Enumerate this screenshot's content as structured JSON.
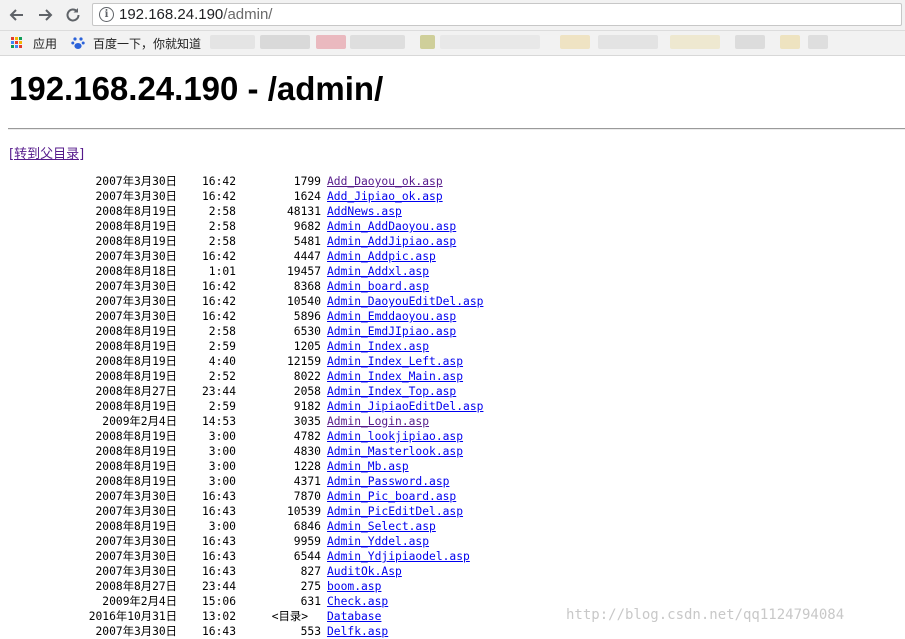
{
  "browser": {
    "url_host": "192.168.24.190",
    "url_path": "/admin/",
    "bookmarks": [
      {
        "label": "应用",
        "icon": "apps-grid-icon"
      },
      {
        "label": "百度一下，你就知道",
        "icon": "baidu-paw-icon"
      }
    ]
  },
  "page": {
    "title": "192.168.24.190 - /admin/",
    "parent_link": "[转到父目录]",
    "entries": [
      {
        "date": "2007年3月30日",
        "time": "16:42",
        "size": "1799",
        "name": "Add_Daoyou_ok.asp",
        "visited": true
      },
      {
        "date": "2007年3月30日",
        "time": "16:42",
        "size": "1624",
        "name": "Add_Jipiao_ok.asp",
        "visited": false
      },
      {
        "date": "2008年8月19日",
        "time": "2:58",
        "size": "48131",
        "name": "AddNews.asp",
        "visited": false
      },
      {
        "date": "2008年8月19日",
        "time": "2:58",
        "size": "9682",
        "name": "Admin_AddDaoyou.asp",
        "visited": false
      },
      {
        "date": "2008年8月19日",
        "time": "2:58",
        "size": "5481",
        "name": "Admin_AddJipiao.asp",
        "visited": false
      },
      {
        "date": "2007年3月30日",
        "time": "16:42",
        "size": "4447",
        "name": "Admin_Addpic.asp",
        "visited": false
      },
      {
        "date": "2008年8月18日",
        "time": "1:01",
        "size": "19457",
        "name": "Admin_Addxl.asp",
        "visited": false
      },
      {
        "date": "2007年3月30日",
        "time": "16:42",
        "size": "8368",
        "name": "Admin_board.asp",
        "visited": false
      },
      {
        "date": "2007年3月30日",
        "time": "16:42",
        "size": "10540",
        "name": "Admin_DaoyouEditDel.asp",
        "visited": false
      },
      {
        "date": "2007年3月30日",
        "time": "16:42",
        "size": "5896",
        "name": "Admin_Emddaoyou.asp",
        "visited": false
      },
      {
        "date": "2008年8月19日",
        "time": "2:58",
        "size": "6530",
        "name": "Admin_EmdJIpiao.asp",
        "visited": false
      },
      {
        "date": "2008年8月19日",
        "time": "2:59",
        "size": "1205",
        "name": "Admin_Index.asp",
        "visited": false
      },
      {
        "date": "2008年8月19日",
        "time": "4:40",
        "size": "12159",
        "name": "Admin_Index_Left.asp",
        "visited": false
      },
      {
        "date": "2008年8月19日",
        "time": "2:52",
        "size": "8022",
        "name": "Admin_Index_Main.asp",
        "visited": false
      },
      {
        "date": "2008年8月27日",
        "time": "23:44",
        "size": "2058",
        "name": "Admin_Index_Top.asp",
        "visited": false
      },
      {
        "date": "2008年8月19日",
        "time": "2:59",
        "size": "9182",
        "name": "Admin_JipiaoEditDel.asp",
        "visited": false
      },
      {
        "date": "2009年2月4日",
        "time": "14:53",
        "size": "3035",
        "name": "Admin_Login.asp",
        "visited": true
      },
      {
        "date": "2008年8月19日",
        "time": "3:00",
        "size": "4782",
        "name": "Admin_lookjipiao.asp",
        "visited": false
      },
      {
        "date": "2008年8月19日",
        "time": "3:00",
        "size": "4830",
        "name": "Admin_Masterlook.asp",
        "visited": false
      },
      {
        "date": "2008年8月19日",
        "time": "3:00",
        "size": "1228",
        "name": "Admin_Mb.asp",
        "visited": false
      },
      {
        "date": "2008年8月19日",
        "time": "3:00",
        "size": "4371",
        "name": "Admin_Password.asp",
        "visited": false
      },
      {
        "date": "2007年3月30日",
        "time": "16:43",
        "size": "7870",
        "name": "Admin_Pic_board.asp",
        "visited": false
      },
      {
        "date": "2007年3月30日",
        "time": "16:43",
        "size": "10539",
        "name": "Admin_PicEditDel.asp",
        "visited": false
      },
      {
        "date": "2008年8月19日",
        "time": "3:00",
        "size": "6846",
        "name": "Admin_Select.asp",
        "visited": false
      },
      {
        "date": "2007年3月30日",
        "time": "16:43",
        "size": "9959",
        "name": "Admin_Yddel.asp",
        "visited": false
      },
      {
        "date": "2007年3月30日",
        "time": "16:43",
        "size": "6544",
        "name": "Admin_Ydjipiaodel.asp",
        "visited": false
      },
      {
        "date": "2007年3月30日",
        "time": "16:43",
        "size": "827",
        "name": "AuditOk.Asp",
        "visited": false
      },
      {
        "date": "2008年8月27日",
        "time": "23:44",
        "size": "275",
        "name": "boom.asp",
        "visited": false
      },
      {
        "date": "2009年2月4日",
        "time": "15:06",
        "size": "631",
        "name": "Check.asp",
        "visited": false
      },
      {
        "date": "2016年10月31日",
        "time": "13:02",
        "size": "",
        "dir_label": "<目录>",
        "name": "Database",
        "visited": false
      },
      {
        "date": "2007年3月30日",
        "time": "16:43",
        "size": "553",
        "name": "Delfk.asp",
        "visited": false
      }
    ]
  },
  "watermark": "http://blog.csdn.net/qq1124794084",
  "colors": {
    "link": "#0000ee",
    "visited": "#551a8b"
  }
}
